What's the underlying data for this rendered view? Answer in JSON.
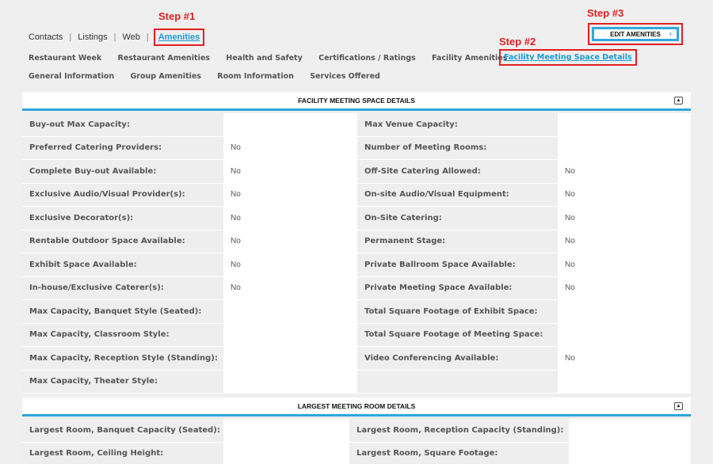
{
  "steps": {
    "one": "Step #1",
    "two": "Step #2",
    "three": "Step #3"
  },
  "top_nav": {
    "contacts": "Contacts",
    "listings": "Listings",
    "web": "Web",
    "amenities": "Amenities",
    "separator": "|"
  },
  "edit_button": {
    "label": "EDIT AMENITIES",
    "chevron": "›"
  },
  "categories_row1": [
    "Restaurant Week",
    "Restaurant Amenities",
    "Health and Safety",
    "Certifications / Ratings",
    "Facility Amenities"
  ],
  "category_active": "Facility Meeting Space Details",
  "categories_row2": [
    "General Information",
    "Group Amenities",
    "Room Information",
    "Services Offered"
  ],
  "section1": {
    "title": "FACILITY MEETING SPACE DETAILS",
    "collapse_icon": "▲",
    "rows": [
      [
        "Buy-out Max Capacity:",
        "",
        "Max Venue Capacity:",
        ""
      ],
      [
        "Preferred Catering Providers:",
        "No",
        "Number of Meeting Rooms:",
        ""
      ],
      [
        "Complete Buy-out Available:",
        "No",
        "Off-Site Catering Allowed:",
        "No"
      ],
      [
        "Exclusive Audio/Visual Provider(s):",
        "No",
        "On-site Audio/Visual Equipment:",
        "No"
      ],
      [
        "Exclusive Decorator(s):",
        "No",
        "On-Site Catering:",
        "No"
      ],
      [
        "Rentable Outdoor Space Available:",
        "No",
        "Permanent Stage:",
        "No"
      ],
      [
        "Exhibit Space Available:",
        "No",
        "Private Ballroom Space Available:",
        "No"
      ],
      [
        "In-house/Exclusive Caterer(s):",
        "No",
        "Private Meeting Space Available:",
        "No"
      ],
      [
        "Max Capacity, Banquet Style (Seated):",
        "",
        "Total Square Footage of Exhibit Space:",
        ""
      ],
      [
        "Max Capacity, Classroom Style:",
        "",
        "Total Square Footage of Meeting Space:",
        ""
      ],
      [
        "Max Capacity, Reception Style (Standing):",
        "",
        "Video Conferencing Available:",
        "No"
      ],
      [
        "Max Capacity, Theater Style:",
        "",
        "",
        ""
      ]
    ]
  },
  "section2": {
    "title": "LARGEST MEETING ROOM DETAILS",
    "collapse_icon": "▲",
    "rows": [
      [
        "Largest Room, Banquet Capacity (Seated):",
        "",
        "Largest Room, Reception Capacity (Standing):",
        ""
      ],
      [
        "Largest Room, Ceiling Height:",
        "",
        "Largest Room, Square Footage:",
        ""
      ]
    ]
  }
}
